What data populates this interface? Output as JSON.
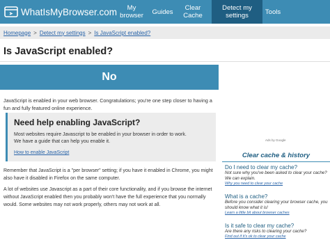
{
  "nav": {
    "logo_text": "WhatIsMyBrowser.com",
    "items": [
      {
        "label": "My browser"
      },
      {
        "label": "Guides"
      },
      {
        "label": "Clear Cache"
      },
      {
        "label": "Detect my settings"
      },
      {
        "label": "Tools"
      }
    ]
  },
  "breadcrumb": {
    "home": "Homepage",
    "sep1": ">",
    "detect": "Detect my settings",
    "sep2": ">",
    "current": "Is JavaScript enabled?"
  },
  "main": {
    "title": "Is JavaScript enabled?",
    "result": "No",
    "intro": "JavaScript is enabled in your web browser. Congratulations; you're one step closer to having a fun and fully featured online experience.",
    "help": {
      "title": "Need help enabling JavaScript?",
      "line1": "Most websites require Javascript to be enabled in your browser in order to work.",
      "line2": "We have a guide that can help you enable it.",
      "link": "How to enable JavaScript"
    },
    "para1": "Remember that JavaScript is a \"per browser\" setting; if you have it enabled in Chrome, you might also have it disabled in Firefox on the same computer.",
    "para2": "A lot of websites use Javascript as a part of their core functionality, and if you browse the internet without JavaScript enabled then you probably won't have the full experience that you normally would. Some websites may not work properly, others may not work at all."
  },
  "sidebar": {
    "ads_label": "Ads by Google",
    "title": "Clear cache & history",
    "items": [
      {
        "q": "Do I need to clear my cache?",
        "a": "Not sure why you've been asked to clear your cache? We can explain.",
        "link": "Why you need to clear your cache"
      },
      {
        "q": "What is a cache?",
        "a": "Before you consider clearing your browser cache, you should know what it is!",
        "link": "Learn a little bit about browser caches"
      },
      {
        "q": "Is it safe to clear my cache?",
        "a": "Are there any risks to clearing your cache?",
        "link": "Find out if it's ok to clear your cache"
      }
    ]
  },
  "colors": {
    "accent": "#3d8cb4",
    "active_nav": "#1f5e82",
    "link": "#2863a8"
  }
}
